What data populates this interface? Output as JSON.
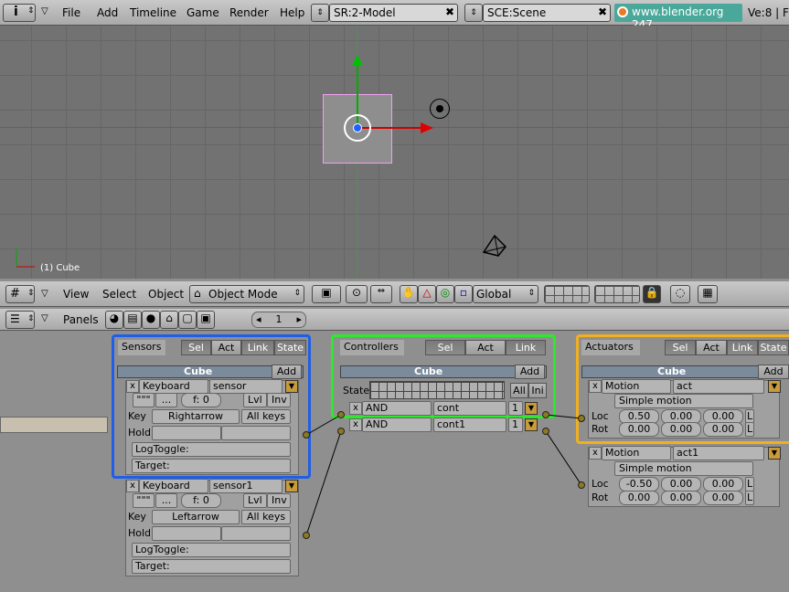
{
  "top_menu": {
    "items": [
      "File",
      "Add",
      "Timeline",
      "Game",
      "Render",
      "Help"
    ],
    "screen": "SR:2-Model",
    "scene": "SCE:Scene",
    "website": "www.blender.org 247",
    "stats": "Ve:8 | F"
  },
  "viewport": {
    "object_label": "(1) Cube"
  },
  "view3d_header": {
    "menus": [
      "View",
      "Select",
      "Object"
    ],
    "mode": "Object Mode",
    "orientation": "Global"
  },
  "buttons_header": {
    "panels_label": "Panels",
    "page": "1"
  },
  "sensors": {
    "title": "Sensors",
    "sel": "Sel",
    "act": "Act",
    "link": "Link",
    "state": "State",
    "object": "Cube",
    "add": "Add",
    "items": [
      {
        "type": "Keyboard",
        "name": "sensor",
        "dots1": "\"\"\"",
        "dots2": "...",
        "freq": "f: 0",
        "lvl": "Lvl",
        "inv": "Inv",
        "key_label": "Key",
        "key": "Rightarrow",
        "all_keys": "All keys",
        "hold": "Hold",
        "logtoggle": "LogToggle:",
        "target": "Target:"
      },
      {
        "type": "Keyboard",
        "name": "sensor1",
        "dots1": "\"\"\"",
        "dots2": "...",
        "freq": "f: 0",
        "lvl": "Lvl",
        "inv": "Inv",
        "key_label": "Key",
        "key": "Leftarrow",
        "all_keys": "All keys",
        "hold": "Hold",
        "logtoggle": "LogToggle:",
        "target": "Target:"
      }
    ]
  },
  "controllers": {
    "title": "Controllers",
    "sel": "Sel",
    "act": "Act",
    "link": "Link",
    "object": "Cube",
    "add": "Add",
    "state": "State",
    "all": "All",
    "ini": "Ini",
    "items": [
      {
        "type": "AND",
        "name": "cont",
        "num": "1"
      },
      {
        "type": "AND",
        "name": "cont1",
        "num": "1"
      }
    ]
  },
  "actuators": {
    "title": "Actuators",
    "sel": "Sel",
    "act": "Act",
    "link": "Link",
    "state": "State",
    "object": "Cube",
    "add": "Add",
    "items": [
      {
        "type": "Motion",
        "name": "act",
        "mode": "Simple motion",
        "loc": "Loc",
        "rot": "Rot",
        "lx": "0.50",
        "ly": "0.00",
        "lz": "0.00",
        "rx": "0.00",
        "ry": "0.00",
        "rz": "0.00",
        "l": "L"
      },
      {
        "type": "Motion",
        "name": "act1",
        "mode": "Simple motion",
        "loc": "Loc",
        "rot": "Rot",
        "lx": "-0.50",
        "ly": "0.00",
        "lz": "0.00",
        "rx": "0.00",
        "ry": "0.00",
        "rz": "0.00",
        "l": "L"
      }
    ]
  },
  "colors": {
    "sensor_outline": "#1f5ee8",
    "controller_outline": "#2ee82e",
    "actuator_outline": "#f0b020",
    "website_bg": "#4aa89a"
  }
}
